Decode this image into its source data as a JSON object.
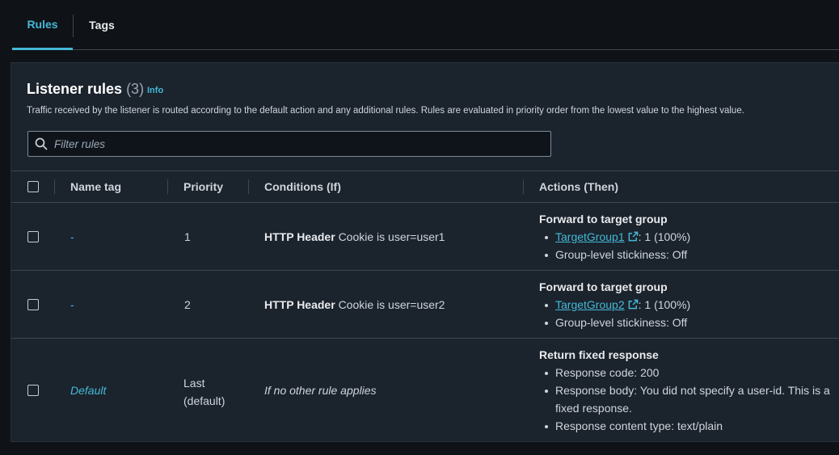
{
  "tabs": {
    "rules": "Rules",
    "tags": "Tags"
  },
  "panel": {
    "title": "Listener rules",
    "count": "(3)",
    "info": "Info",
    "description": "Traffic received by the listener is routed according to the default action and any additional rules. Rules are evaluated in priority order from the lowest value to the highest value."
  },
  "filter": {
    "placeholder": "Filter rules"
  },
  "columns": {
    "name_tag": "Name tag",
    "priority": "Priority",
    "conditions": "Conditions (If)",
    "actions": "Actions (Then)"
  },
  "rows": [
    {
      "name": "-",
      "priority": "1",
      "condition_label": "HTTP Header",
      "condition_value": "Cookie is user=user1",
      "action_title": "Forward to target group",
      "target_group": "TargetGroup1",
      "target_weight": ": 1 (100%)",
      "stickiness": "Group-level stickiness: Off"
    },
    {
      "name": "-",
      "priority": "2",
      "condition_label": "HTTP Header",
      "condition_value": "Cookie is user=user2",
      "action_title": "Forward to target group",
      "target_group": "TargetGroup2",
      "target_weight": ": 1 (100%)",
      "stickiness": "Group-level stickiness: Off"
    }
  ],
  "default_row": {
    "name": "Default",
    "priority_line1": "Last",
    "priority_line2": "(default)",
    "condition": "If no other rule applies",
    "action_title": "Return fixed response",
    "response_code": "Response code: 200",
    "response_body": "Response body: You did not specify a user-id. This is a fixed response.",
    "content_type": "Response content type: text/plain"
  },
  "colors": {
    "accent": "#44b9d6",
    "panel_bg": "#1b232d",
    "page_bg": "#0f1217"
  }
}
